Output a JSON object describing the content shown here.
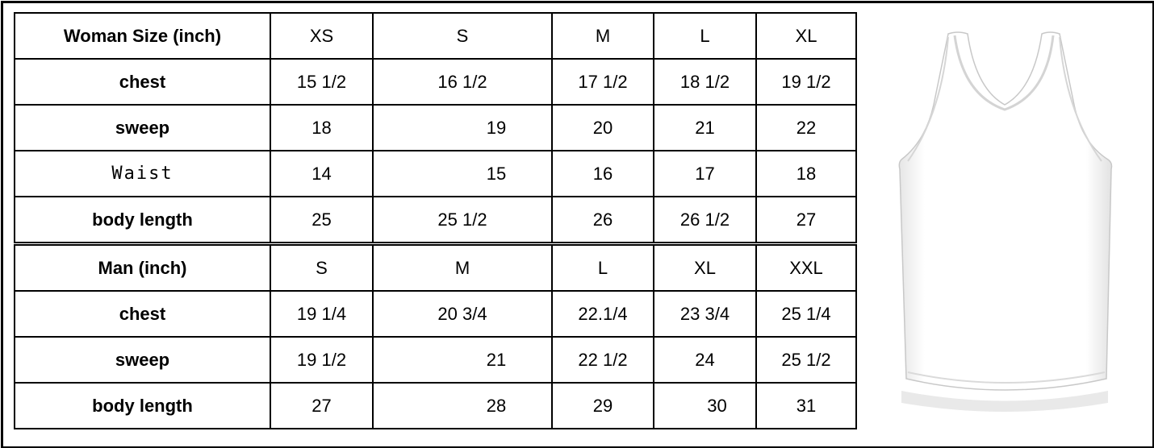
{
  "woman": {
    "header": [
      "Woman Size (inch)",
      "XS",
      "S",
      "M",
      "L",
      "XL"
    ],
    "rows": [
      [
        "chest",
        "15 1/2",
        "16  1/2",
        "17  1/2",
        "18 1/2",
        "19 1/2"
      ],
      [
        "sweep",
        "18",
        "19",
        "20",
        "21",
        "22"
      ],
      [
        "Waist",
        "14",
        "15",
        "16",
        "17",
        "18"
      ],
      [
        "body length",
        "25",
        "25  1/2",
        "26",
        "26 1/2",
        "27"
      ]
    ]
  },
  "man": {
    "header": [
      "Man (inch)",
      "S",
      "M",
      "L",
      "XL",
      "XXL"
    ],
    "rows": [
      [
        "chest",
        "19 1/4",
        "20  3/4",
        "22.1/4",
        "23 3/4",
        "25 1/4"
      ],
      [
        "sweep",
        "19 1/2",
        "21",
        "22 1/2",
        "24",
        "25 1/2"
      ],
      [
        "body length",
        "27",
        "28",
        "29",
        "30",
        "31"
      ]
    ]
  },
  "image": {
    "icon": "tank-top-garment",
    "color": "#ffffff",
    "shadow": "#d8d8d8"
  }
}
